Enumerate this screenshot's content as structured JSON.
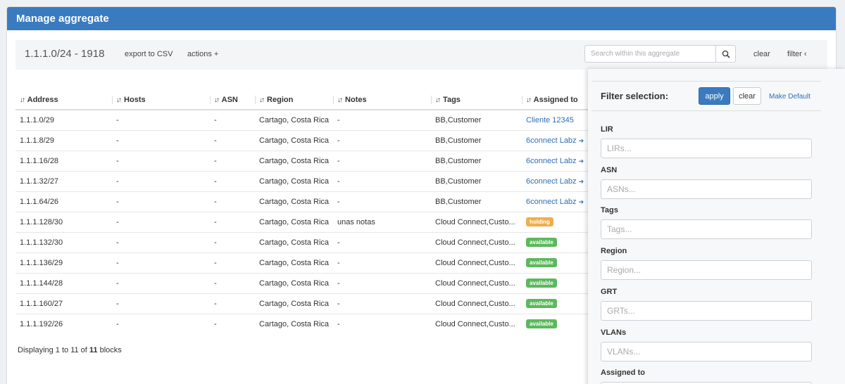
{
  "header": {
    "title": "Manage aggregate"
  },
  "toolbar": {
    "aggregate_title": "1.1.1.0/24 - 1918",
    "export_label": "export to CSV",
    "actions_label": "actions +",
    "search_placeholder": "Search within this aggregate",
    "clear_label": "clear",
    "filter_label": "filter ‹"
  },
  "table": {
    "columns": [
      "Address",
      "Hosts",
      "ASN",
      "Region",
      "Notes",
      "Tags",
      "Assigned to"
    ],
    "rows": [
      {
        "address": "1.1.1.0/29",
        "hosts": "-",
        "asn": "-",
        "region": "Cartago, Costa Rica",
        "notes": "-",
        "tags": "BB,Customer",
        "assigned": "Cliente 12345",
        "assigned_type": "link"
      },
      {
        "address": "1.1.1.8/29",
        "hosts": "-",
        "asn": "-",
        "region": "Cartago, Costa Rica",
        "notes": "-",
        "tags": "BB,Customer",
        "assigned": "6connect Labz",
        "assigned_type": "link-arrow"
      },
      {
        "address": "1.1.1.16/28",
        "hosts": "-",
        "asn": "-",
        "region": "Cartago, Costa Rica",
        "notes": "-",
        "tags": "BB,Customer",
        "assigned": "6connect Labz",
        "assigned_type": "link-arrow"
      },
      {
        "address": "1.1.1.32/27",
        "hosts": "-",
        "asn": "-",
        "region": "Cartago, Costa Rica",
        "notes": "-",
        "tags": "BB,Customer",
        "assigned": "6connect Labz",
        "assigned_type": "link-arrow"
      },
      {
        "address": "1.1.1.64/26",
        "hosts": "-",
        "asn": "-",
        "region": "Cartago, Costa Rica",
        "notes": "-",
        "tags": "BB,Customer",
        "assigned": "6connect Labz",
        "assigned_type": "link-arrow"
      },
      {
        "address": "1.1.1.128/30",
        "hosts": "-",
        "asn": "-",
        "region": "Cartago, Costa Rica",
        "notes": "unas notas",
        "tags": "Cloud Connect,Custo...",
        "assigned": "holding",
        "assigned_type": "badge-holding"
      },
      {
        "address": "1.1.1.132/30",
        "hosts": "-",
        "asn": "-",
        "region": "Cartago, Costa Rica",
        "notes": "-",
        "tags": "Cloud Connect,Custo...",
        "assigned": "available",
        "assigned_type": "badge-available"
      },
      {
        "address": "1.1.1.136/29",
        "hosts": "-",
        "asn": "-",
        "region": "Cartago, Costa Rica",
        "notes": "-",
        "tags": "Cloud Connect,Custo...",
        "assigned": "available",
        "assigned_type": "badge-available"
      },
      {
        "address": "1.1.1.144/28",
        "hosts": "-",
        "asn": "-",
        "region": "Cartago, Costa Rica",
        "notes": "-",
        "tags": "Cloud Connect,Custo...",
        "assigned": "available",
        "assigned_type": "badge-available"
      },
      {
        "address": "1.1.1.160/27",
        "hosts": "-",
        "asn": "-",
        "region": "Cartago, Costa Rica",
        "notes": "-",
        "tags": "Cloud Connect,Custo...",
        "assigned": "available",
        "assigned_type": "badge-available"
      },
      {
        "address": "1.1.1.192/26",
        "hosts": "-",
        "asn": "-",
        "region": "Cartago, Costa Rica",
        "notes": "-",
        "tags": "Cloud Connect,Custo...",
        "assigned": "available",
        "assigned_type": "badge-available"
      }
    ]
  },
  "footer": {
    "prefix": "Displaying 1 to 11 of ",
    "total": "11",
    "suffix": " blocks"
  },
  "filter_panel": {
    "title": "Filter selection:",
    "apply_label": "apply",
    "clear_label": "clear",
    "make_default_label": "Make Default",
    "fields": [
      {
        "label": "LIR",
        "placeholder": "LIRs..."
      },
      {
        "label": "ASN",
        "placeholder": "ASNs..."
      },
      {
        "label": "Tags",
        "placeholder": "Tags..."
      },
      {
        "label": "Region",
        "placeholder": "Region..."
      },
      {
        "label": "GRT",
        "placeholder": "GRTs..."
      },
      {
        "label": "VLANs",
        "placeholder": "VLANs..."
      },
      {
        "label": "Assigned to",
        "placeholder": ""
      }
    ]
  },
  "colors": {
    "header": "#3a7bc0",
    "link": "#2f6fb3",
    "holding": "#f0ad4e",
    "available": "#5cb85c"
  },
  "icons": {
    "search": "search-icon",
    "sort": "sort-icon",
    "arrow": "arrow-right-icon"
  }
}
